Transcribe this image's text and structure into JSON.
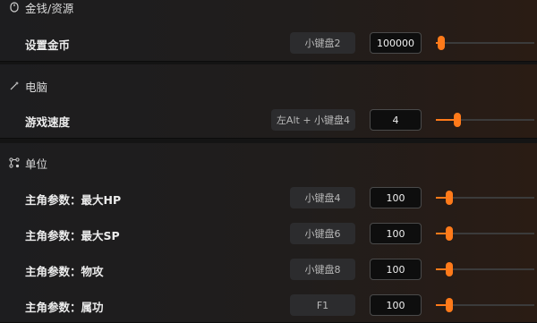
{
  "sections": [
    {
      "title": "金钱/资源",
      "icon": "mouse-icon",
      "rows": [
        {
          "label": "设置金币",
          "hotkey": "小键盘2",
          "value": "100000",
          "slider_fraction": 0.02
        }
      ]
    },
    {
      "title": "电脑",
      "icon": "wand-icon",
      "rows": [
        {
          "label": "游戏速度",
          "hotkey": "左Alt + 小键盘4",
          "value": "4",
          "slider_fraction": 0.18
        }
      ]
    },
    {
      "title": "单位",
      "icon": "nodes-icon",
      "rows": [
        {
          "label": "主角参数：最大HP",
          "hotkey": "小键盘4",
          "value": "100",
          "slider_fraction": 0.1
        },
        {
          "label": "主角参数：最大SP",
          "hotkey": "小键盘6",
          "value": "100",
          "slider_fraction": 0.1
        },
        {
          "label": "主角参数：物攻",
          "hotkey": "小键盘8",
          "value": "100",
          "slider_fraction": 0.1
        },
        {
          "label": "主角参数：属功",
          "hotkey": "F1",
          "value": "100",
          "slider_fraction": 0.1
        }
      ]
    }
  ],
  "colors": {
    "accent": "#ff7a1a",
    "panel": "#1d1d1f",
    "input_bg": "#0e0e0e"
  }
}
